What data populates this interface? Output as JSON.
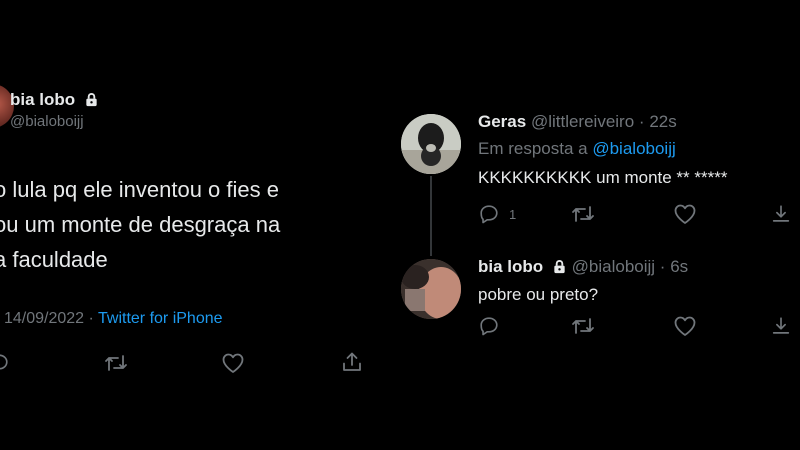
{
  "left_tweet": {
    "name": "bia lobo",
    "handle": "@bialoboijj",
    "text_lines": [
      "o lula pq ele inventou o fies e",
      "ou um monte de desgraça na",
      "a faculdade"
    ],
    "date": "14/09/2022",
    "separator": "·",
    "source": "Twitter for iPhone"
  },
  "reply_1": {
    "name": "Geras",
    "handle": "@littlereiveiro",
    "separator": "·",
    "time": "22s",
    "replying_label": "Em resposta a",
    "replying_to": "@bialoboijj",
    "text": "KKKKKKKKKK um monte ** *****",
    "reply_count": "1"
  },
  "reply_2": {
    "name": "bia lobo",
    "handle": "@bialoboijj",
    "separator": "·",
    "time": "6s",
    "text": "pobre ou preto?"
  },
  "colors": {
    "background": "#000000",
    "text": "#e7e9ea",
    "muted": "#71767b",
    "link": "#1d9bf0",
    "thread_line": "#333639"
  },
  "icons": [
    "lock-icon",
    "reply-icon",
    "retweet-icon",
    "like-icon",
    "share-icon"
  ]
}
